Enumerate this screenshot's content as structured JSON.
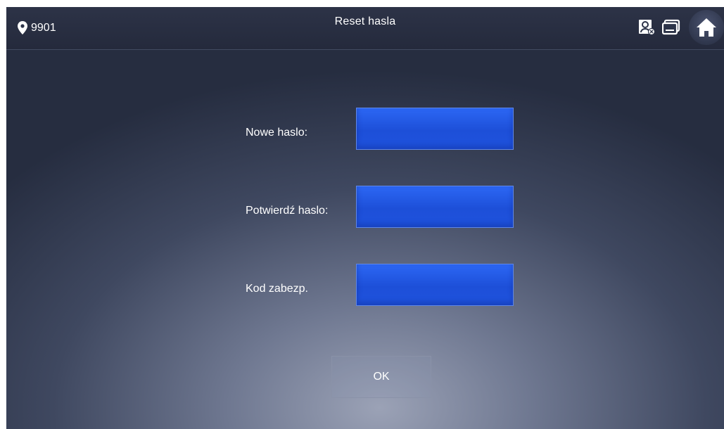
{
  "header": {
    "location_code": "9901",
    "title": "Reset hasla"
  },
  "icons": {
    "location": "location-pin-icon",
    "contacts": "contact-card-icon",
    "device": "device-monitor-icon",
    "home": "home-icon"
  },
  "form": {
    "new_password_label": "Nowe haslo:",
    "confirm_password_label": "Potwierdź haslo:",
    "security_code_label": "Kod zabezp.",
    "new_password_value": "",
    "confirm_password_value": "",
    "security_code_value": ""
  },
  "buttons": {
    "ok_label": "OK"
  },
  "colors": {
    "field_blue": "#1f53de",
    "background_dark": "#262d40",
    "text": "#ffffff"
  }
}
